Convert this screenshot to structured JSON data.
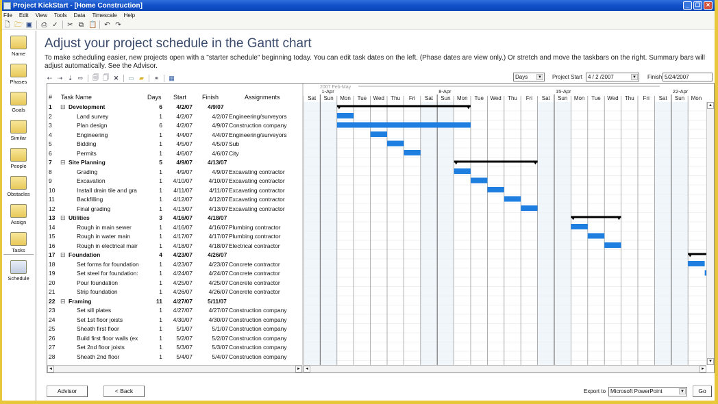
{
  "window": {
    "title": "Project KickStart - [Home Construction]",
    "controls": [
      "minimize",
      "restore",
      "close"
    ]
  },
  "menu": [
    "File",
    "Edit",
    "View",
    "Tools",
    "Data",
    "Timescale",
    "Help"
  ],
  "toolbar_icons": [
    "new-file-icon",
    "open-folder-icon",
    "save-icon",
    "print-icon",
    "spellcheck-icon",
    "cut-icon",
    "copy-icon",
    "paste-icon",
    "undo-icon",
    "redo-icon"
  ],
  "sidebar": {
    "items": [
      {
        "label": "Name",
        "icon": "name-icon"
      },
      {
        "label": "Phases",
        "icon": "phases-icon"
      },
      {
        "label": "Goals",
        "icon": "goals-icon"
      },
      {
        "label": "Similar",
        "icon": "similar-icon"
      },
      {
        "label": "People",
        "icon": "people-icon"
      },
      {
        "label": "Obstacles",
        "icon": "obstacles-icon"
      },
      {
        "label": "Assign",
        "icon": "assign-icon"
      },
      {
        "label": "Tasks",
        "icon": "tasks-icon"
      },
      {
        "label": "Schedule",
        "icon": "schedule-icon"
      }
    ],
    "active": "Schedule"
  },
  "main": {
    "title": "Adjust your project schedule in the Gantt chart",
    "description": "To make scheduling easier, new projects open with a \"starter schedule\" beginning today. You can edit task dates on the left. (Phase dates are view only.) Or stretch and move the taskbars on the right. Summary bars will adjust automatically. See the Advisor.",
    "gantt_toolbar_icons": [
      "outdent-icon",
      "indent-icon",
      "move-down-icon",
      "move-right-icon",
      "insert-task-icon",
      "copy-task-icon",
      "delete-icon",
      "folder-icon",
      "note-icon",
      "link-icon",
      "calendar-icon"
    ],
    "timescale": {
      "value": "Days"
    },
    "project_start": {
      "label": "Project Start",
      "value": "4 / 2 /2007"
    },
    "finish": {
      "label": "Finish",
      "value": "5/24/2007"
    }
  },
  "table": {
    "headers": {
      "num": "#",
      "name": "Task Name",
      "days": "Days",
      "start": "Start",
      "finish": "Finish",
      "assign": "Assignments"
    },
    "rows": [
      {
        "num": "1",
        "name": "Development",
        "days": "6",
        "start": "4/2/07",
        "finish": "4/9/07",
        "assign": "",
        "summary": true
      },
      {
        "num": "2",
        "name": "Land survey",
        "days": "1",
        "start": "4/2/07",
        "finish": "4/2/07",
        "assign": "Engineering/surveyors"
      },
      {
        "num": "3",
        "name": "Plan design",
        "days": "6",
        "start": "4/2/07",
        "finish": "4/9/07",
        "assign": "Construction company"
      },
      {
        "num": "4",
        "name": "Engineering",
        "days": "1",
        "start": "4/4/07",
        "finish": "4/4/07",
        "assign": "Engineering/surveyors"
      },
      {
        "num": "5",
        "name": "Bidding",
        "days": "1",
        "start": "4/5/07",
        "finish": "4/5/07",
        "assign": "Sub"
      },
      {
        "num": "6",
        "name": "Permits",
        "days": "1",
        "start": "4/6/07",
        "finish": "4/6/07",
        "assign": "City"
      },
      {
        "num": "7",
        "name": "Site Planning",
        "days": "5",
        "start": "4/9/07",
        "finish": "4/13/07",
        "assign": "",
        "summary": true
      },
      {
        "num": "8",
        "name": "Grading",
        "days": "1",
        "start": "4/9/07",
        "finish": "4/9/07",
        "assign": "Excavating contractor"
      },
      {
        "num": "9",
        "name": "Excavation",
        "days": "1",
        "start": "4/10/07",
        "finish": "4/10/07",
        "assign": "Excavating contractor"
      },
      {
        "num": "10",
        "name": "Install drain tile and gra",
        "days": "1",
        "start": "4/11/07",
        "finish": "4/11/07",
        "assign": "Excavating contractor"
      },
      {
        "num": "11",
        "name": "Backfilling",
        "days": "1",
        "start": "4/12/07",
        "finish": "4/12/07",
        "assign": "Excavating contractor"
      },
      {
        "num": "12",
        "name": "Final grading",
        "days": "1",
        "start": "4/13/07",
        "finish": "4/13/07",
        "assign": "Excavating contractor"
      },
      {
        "num": "13",
        "name": "Utilities",
        "days": "3",
        "start": "4/16/07",
        "finish": "4/18/07",
        "assign": "",
        "summary": true
      },
      {
        "num": "14",
        "name": "Rough in main sewer",
        "days": "1",
        "start": "4/16/07",
        "finish": "4/16/07",
        "assign": "Plumbing contractor"
      },
      {
        "num": "15",
        "name": "Rough in water main",
        "days": "1",
        "start": "4/17/07",
        "finish": "4/17/07",
        "assign": "Plumbing contractor"
      },
      {
        "num": "16",
        "name": "Rough in electrical mair",
        "days": "1",
        "start": "4/18/07",
        "finish": "4/18/07",
        "assign": "Electrical contractor"
      },
      {
        "num": "17",
        "name": "Foundation",
        "days": "4",
        "start": "4/23/07",
        "finish": "4/26/07",
        "assign": "",
        "summary": true
      },
      {
        "num": "18",
        "name": "Set forms for foundation",
        "days": "1",
        "start": "4/23/07",
        "finish": "4/23/07",
        "assign": "Concrete contractor"
      },
      {
        "num": "19",
        "name": "Set steel for foundation:",
        "days": "1",
        "start": "4/24/07",
        "finish": "4/24/07",
        "assign": "Concrete contractor"
      },
      {
        "num": "20",
        "name": "Pour foundation",
        "days": "1",
        "start": "4/25/07",
        "finish": "4/25/07",
        "assign": "Concrete contractor"
      },
      {
        "num": "21",
        "name": "Strip foundation",
        "days": "1",
        "start": "4/26/07",
        "finish": "4/26/07",
        "assign": "Concrete contractor"
      },
      {
        "num": "22",
        "name": "Framing",
        "days": "11",
        "start": "4/27/07",
        "finish": "5/11/07",
        "assign": "",
        "summary": true
      },
      {
        "num": "23",
        "name": "Set sill plates",
        "days": "1",
        "start": "4/27/07",
        "finish": "4/27/07",
        "assign": "Construction company"
      },
      {
        "num": "24",
        "name": "Set 1st floor joists",
        "days": "1",
        "start": "4/30/07",
        "finish": "4/30/07",
        "assign": "Construction company"
      },
      {
        "num": "25",
        "name": "Sheath first floor",
        "days": "1",
        "start": "5/1/07",
        "finish": "5/1/07",
        "assign": "Construction company"
      },
      {
        "num": "26",
        "name": "Build first floor walls (ex",
        "days": "1",
        "start": "5/2/07",
        "finish": "5/2/07",
        "assign": "Construction company"
      },
      {
        "num": "27",
        "name": "Set 2nd floor joists",
        "days": "1",
        "start": "5/3/07",
        "finish": "5/3/07",
        "assign": "Construction company"
      },
      {
        "num": "28",
        "name": "Sheath 2nd floor",
        "days": "1",
        "start": "5/4/07",
        "finish": "5/4/07",
        "assign": "Construction company"
      }
    ]
  },
  "gantt": {
    "range_label": "2007 Feb-May",
    "week_labels": [
      {
        "label": "1-Apr",
        "day_index": 1
      },
      {
        "label": "8-Apr",
        "day_index": 8
      },
      {
        "label": "15-Apr",
        "day_index": 15
      },
      {
        "label": "22-Apr",
        "day_index": 22
      }
    ],
    "days": [
      "Sat",
      "Sun",
      "Mon",
      "Tue",
      "Wed",
      "Thu",
      "Fri",
      "Sat",
      "Sun",
      "Mon",
      "Tue",
      "Wed",
      "Thu",
      "Fri",
      "Sat",
      "Sun",
      "Mon",
      "Tue",
      "Wed",
      "Thu",
      "Fri",
      "Sat",
      "Sun",
      "Mon"
    ],
    "first_day": "3/31/07",
    "colors": {
      "task_bar": "#1f7fe0",
      "summary_bar": "#000000",
      "weekend": "#f1f6fb"
    }
  },
  "footer": {
    "advisor_label": "Advisor",
    "back_label": "< Back",
    "export_label": "Export to",
    "export_value": "Microsoft PowerPoint",
    "go_label": "Go"
  }
}
